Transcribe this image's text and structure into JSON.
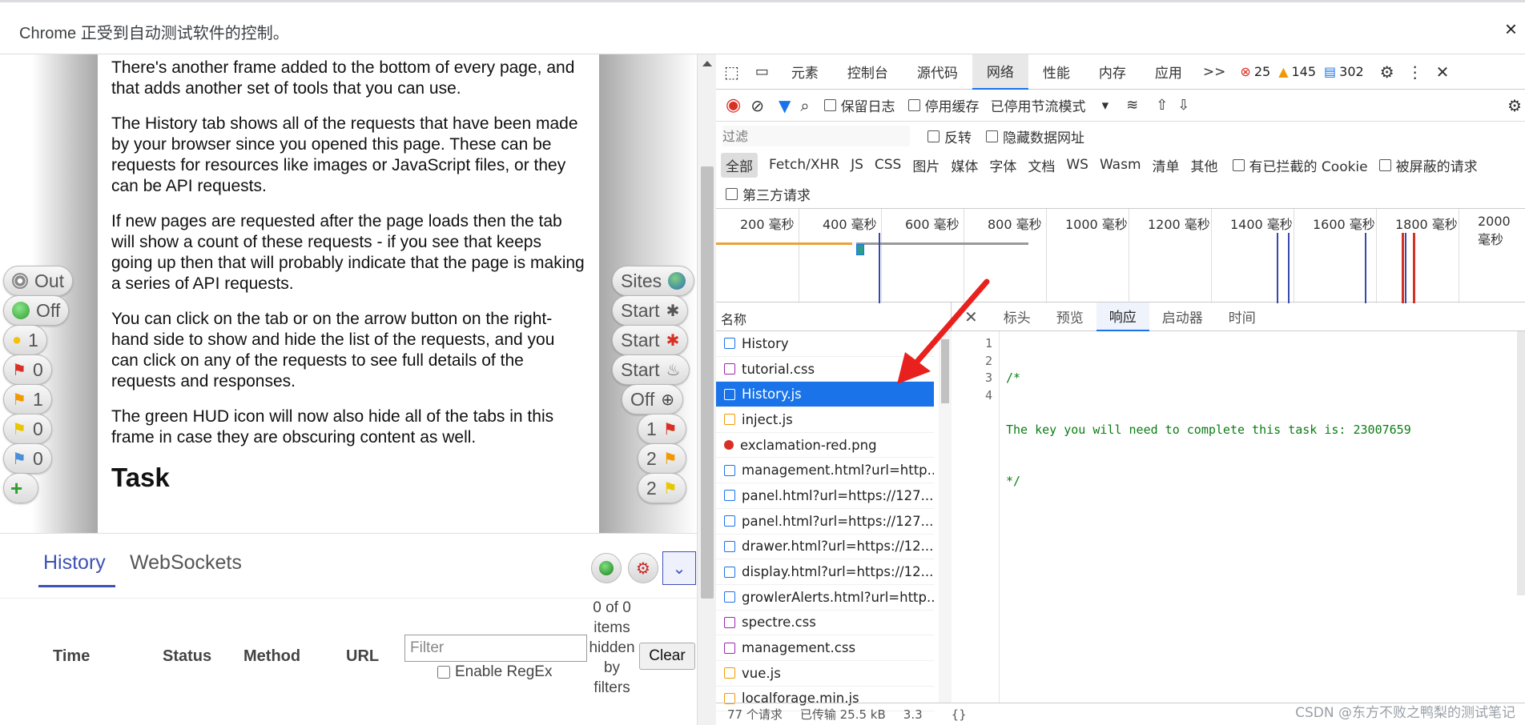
{
  "infobar": {
    "message": "Chrome 正受到自动测试软件的控制。",
    "close": "×"
  },
  "page": {
    "paragraphs": [
      "There's another frame added to the bottom of every page, and that adds another set of tools that you can use.",
      "The History tab shows all of the requests that have been made by your browser since you opened this page. These can be requests for resources like images or JavaScript files, or they can be API requests.",
      "If new pages are requested after the page loads then the tab will show a count of these requests - if you see that keeps going up then that will probably indicate that the page is making a series of API requests.",
      "You can click on the tab or on the arrow button on the right-hand side to show and hide the list of the requests, and you can click on any of the requests to see full details of the requests and responses.",
      "The green HUD icon will now also hide all of the tabs in this frame in case they are obscuring content as well."
    ],
    "heading": "Task"
  },
  "hud_left": [
    {
      "label": "Out",
      "icon": "target-icon"
    },
    {
      "label": "Off",
      "icon": "green-dot-icon"
    },
    {
      "label": "1",
      "icon": "bulb-icon"
    },
    {
      "label": "0",
      "icon": "red-flag-icon"
    },
    {
      "label": "1",
      "icon": "orange-flag-icon"
    },
    {
      "label": "0",
      "icon": "yellow-flag-icon"
    },
    {
      "label": "0",
      "icon": "blue-flag-icon"
    }
  ],
  "hud_right": [
    {
      "label": "Sites",
      "icon": "globe-icon"
    },
    {
      "label": "Start",
      "icon": "spider-icon"
    },
    {
      "label": "Start",
      "icon": "red-spider-icon"
    },
    {
      "label": "Start",
      "icon": "flame-icon"
    },
    {
      "label": "Off",
      "icon": "crosshair-icon"
    },
    {
      "label": "1",
      "icon": "red-flag-icon"
    },
    {
      "label": "2",
      "icon": "orange-flag-icon"
    },
    {
      "label": "2",
      "icon": "yellow-flag-icon"
    }
  ],
  "history_panel": {
    "tabs": [
      "History",
      "WebSockets"
    ],
    "columns": [
      "Time",
      "Status",
      "Method",
      "URL"
    ],
    "filter_placeholder": "Filter",
    "regex_label": "Enable RegEx",
    "hidden_note": "0 of 0 items hidden by filters",
    "clear_label": "Clear"
  },
  "devtools": {
    "tabs": [
      "元素",
      "控制台",
      "源代码",
      "网络",
      "性能",
      "内存",
      "应用"
    ],
    "active_tab": "网络",
    "more": ">>",
    "errors": "25",
    "warnings": "145",
    "messages": "302",
    "toolbar": {
      "preserve_log": "保留日志",
      "disable_cache": "停用缓存",
      "throttle": "已停用节流模式"
    },
    "filter": {
      "placeholder": "过滤",
      "invert": "反转",
      "hide_data_urls": "隐藏数据网址"
    },
    "types": [
      "全部",
      "Fetch/XHR",
      "JS",
      "CSS",
      "图片",
      "媒体",
      "字体",
      "文档",
      "WS",
      "Wasm",
      "清单",
      "其他"
    ],
    "blocked_cookies": "有已拦截的 Cookie",
    "blocked_requests": "被屏蔽的请求",
    "third_party": "第三方请求",
    "timeline_labels": [
      "200 毫秒",
      "400 毫秒",
      "600 毫秒",
      "800 毫秒",
      "1000 毫秒",
      "1200 毫秒",
      "1400 毫秒",
      "1600 毫秒",
      "1800 毫秒",
      "2000 毫秒"
    ],
    "list_header": "名称",
    "requests": [
      {
        "name": "History",
        "type": "doc"
      },
      {
        "name": "tutorial.css",
        "type": "css"
      },
      {
        "name": "History.js",
        "type": "js"
      },
      {
        "name": "inject.js",
        "type": "js"
      },
      {
        "name": "exclamation-red.png",
        "type": "img"
      },
      {
        "name": "management.html?url=http...",
        "type": "doc"
      },
      {
        "name": "panel.html?url=https://127....",
        "type": "doc"
      },
      {
        "name": "panel.html?url=https://127....",
        "type": "doc"
      },
      {
        "name": "drawer.html?url=https://12...",
        "type": "doc"
      },
      {
        "name": "display.html?url=https://12...",
        "type": "doc"
      },
      {
        "name": "growlerAlerts.html?url=http...",
        "type": "doc"
      },
      {
        "name": "spectre.css",
        "type": "css"
      },
      {
        "name": "management.css",
        "type": "css"
      },
      {
        "name": "vue.js",
        "type": "js"
      },
      {
        "name": "localforage.min.js",
        "type": "js"
      }
    ],
    "selected_request": "History.js",
    "detail_tabs": [
      "标头",
      "预览",
      "响应",
      "启动器",
      "时间"
    ],
    "active_detail_tab": "响应",
    "response_lines": [
      "/*",
      "The key you will need to complete this task is: 23007659",
      "*/",
      ""
    ],
    "status": {
      "requests": "77 个请求",
      "transferred": "已传输 25.5 kB",
      "size": "3.3"
    }
  },
  "watermark": "CSDN @东方不败之鸭梨的测试笔记",
  "colors": {
    "accent": "#1a73e8",
    "hud_accent": "#3f51b5",
    "arrow": "#e8211e",
    "code": "#0a7d14"
  }
}
